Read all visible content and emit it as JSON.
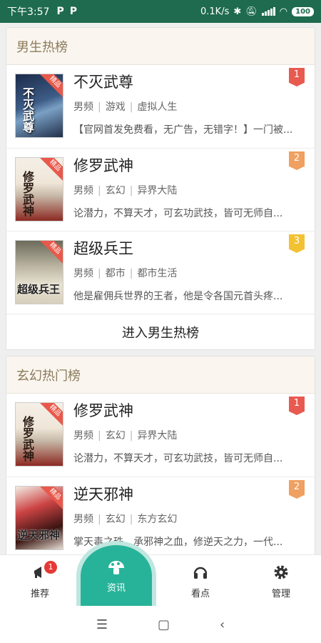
{
  "statusbar": {
    "time": "下午3:57",
    "p1": "P",
    "p2": "P",
    "speed": "0.1K/s",
    "battery": "100"
  },
  "sections": [
    {
      "title": "男生热榜",
      "books": [
        {
          "title": "不灭武尊",
          "tags": [
            "男频",
            "游戏",
            "虚拟人生"
          ],
          "desc": "【官网首发免费看，无广告，无错字！】一门被...",
          "rank": "1",
          "cover_tag": "精品",
          "cover_title": "不灭武尊"
        },
        {
          "title": "修罗武神",
          "tags": [
            "男频",
            "玄幻",
            "异界大陆"
          ],
          "desc": "论潜力，不算天才，可玄功武技，皆可无师自...",
          "rank": "2",
          "cover_tag": "精品",
          "cover_title": "修罗武神"
        },
        {
          "title": "超级兵王",
          "tags": [
            "男频",
            "都市",
            "都市生活"
          ],
          "desc": "他是雇佣兵世界的王者，他是令各国元首头疼...",
          "rank": "3",
          "cover_tag": "精品",
          "cover_title": "超级兵王"
        }
      ],
      "enter_label": "进入男生热榜"
    },
    {
      "title": "玄幻热门榜",
      "books": [
        {
          "title": "修罗武神",
          "tags": [
            "男频",
            "玄幻",
            "异界大陆"
          ],
          "desc": "论潜力，不算天才，可玄功武技，皆可无师自...",
          "rank": "1",
          "cover_tag": "精品",
          "cover_title": "修罗武神"
        },
        {
          "title": "逆天邪神",
          "tags": [
            "男频",
            "玄幻",
            "东方玄幻"
          ],
          "desc": "掌天毒之珠，承邪神之血，修逆天之力，一代...",
          "rank": "2",
          "cover_tag": "精品",
          "cover_title": "逆天邪神"
        }
      ]
    }
  ],
  "rank_colors": {
    "1": "#e85a50",
    "2": "#f0a060",
    "3": "#f2c233"
  },
  "bottomnav": {
    "badge": "1",
    "items": [
      {
        "label": "推荐",
        "icon": "megaphone-icon"
      },
      {
        "label": "资讯",
        "icon": "mushroom-icon"
      },
      {
        "label": "看点",
        "icon": "headphones-icon"
      },
      {
        "label": "管理",
        "icon": "gear-icon"
      }
    ]
  },
  "sysnav": {
    "menu": "☰",
    "home": "▢",
    "back": "‹"
  }
}
